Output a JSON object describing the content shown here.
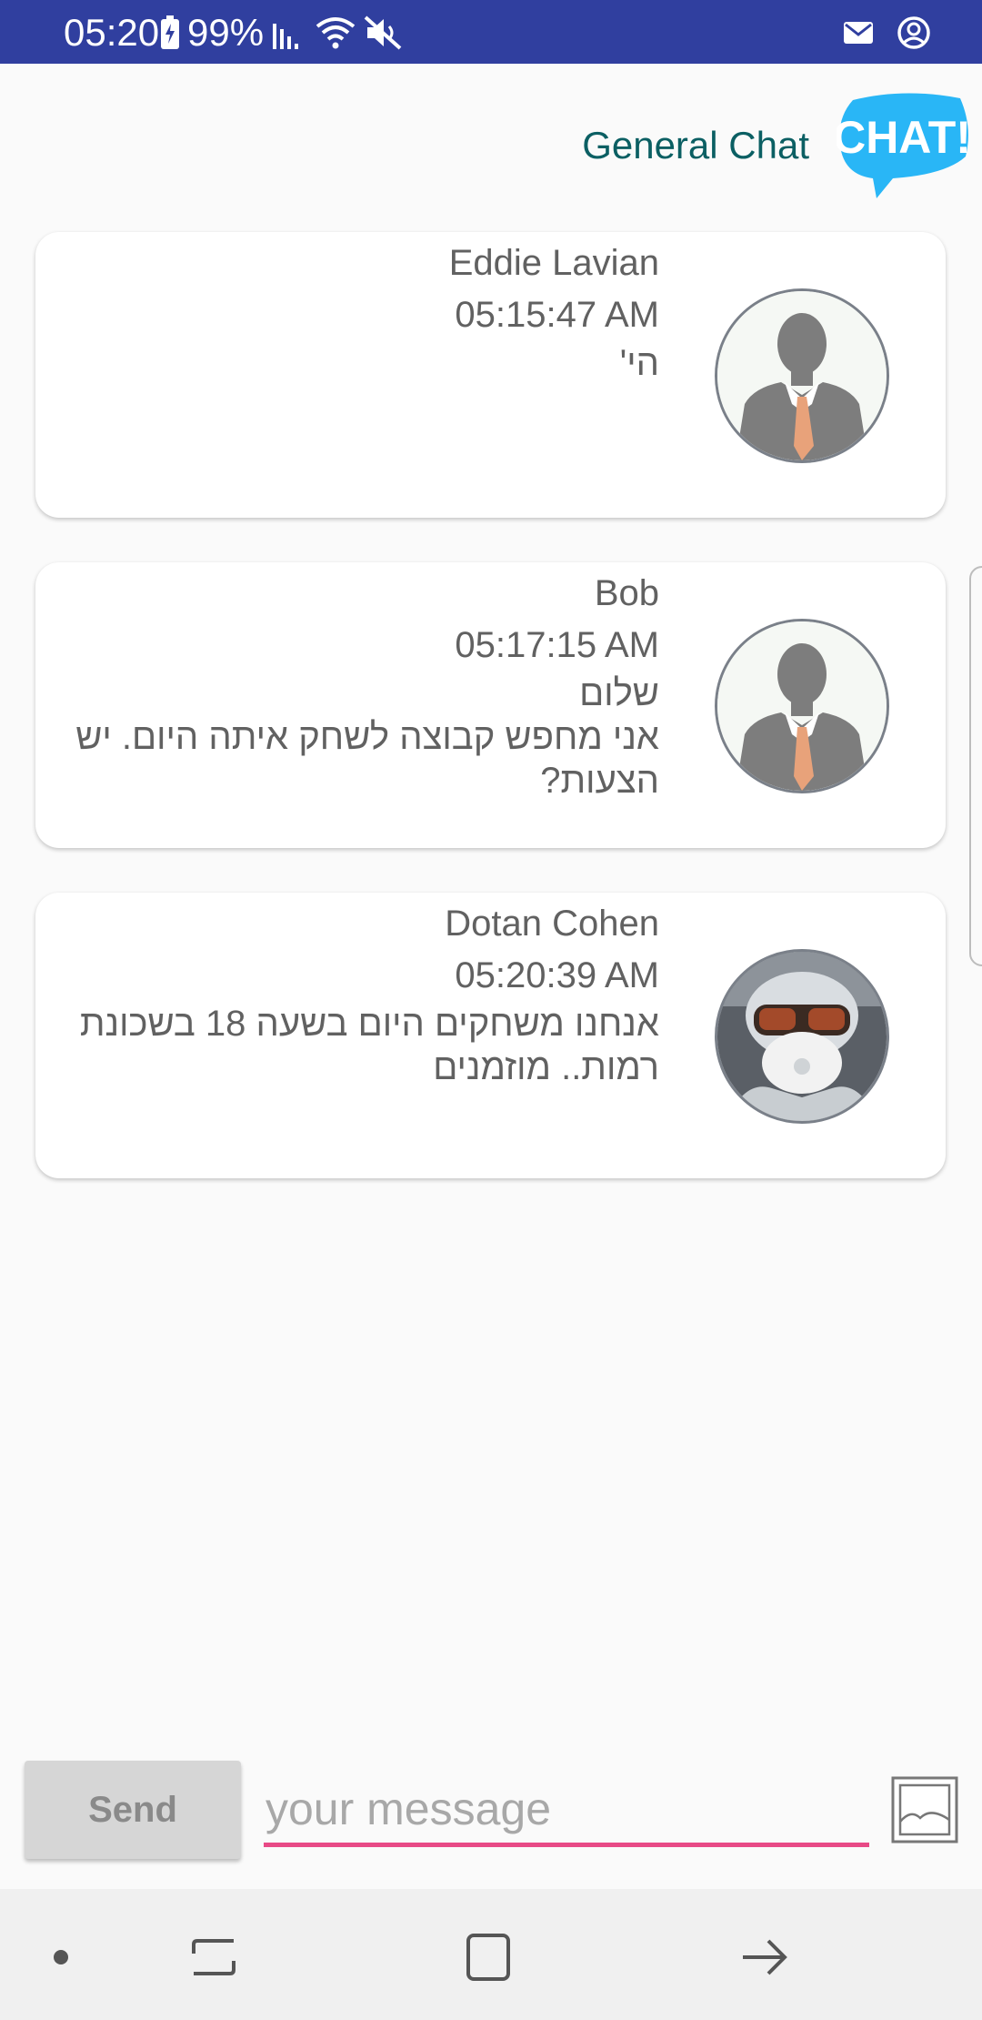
{
  "status_bar": {
    "time": "05:20",
    "battery": "99%",
    "icons": [
      "battery-charging-icon",
      "signal-icon",
      "wifi-icon",
      "mute-icon",
      "mail-icon",
      "account-icon"
    ]
  },
  "header": {
    "title": "General Chat",
    "logo_text": "CHAT!",
    "logo_color": "#29b6f6"
  },
  "messages": [
    {
      "name": "Eddie Lavian",
      "time": "05:15:47 AM",
      "text": "הי'",
      "avatar": "default-person-icon"
    },
    {
      "name": "Bob",
      "time": "05:17:15 AM",
      "text": "שלום\nאני מחפש קבוצה לשחק איתה היום. יש הצעות?",
      "avatar": "default-person-icon"
    },
    {
      "name": "Dotan Cohen",
      "time": "05:20:39 AM",
      "text": "אנחנו משחקים היום בשעה 18 בשכונת רמות.. מוזמנים",
      "avatar": "photo-avatar"
    }
  ],
  "composer": {
    "send_label": "Send",
    "placeholder": "your message",
    "accent": "#e84a86"
  },
  "colors": {
    "status_bar": "#303f9f",
    "title": "#0b5f63"
  }
}
